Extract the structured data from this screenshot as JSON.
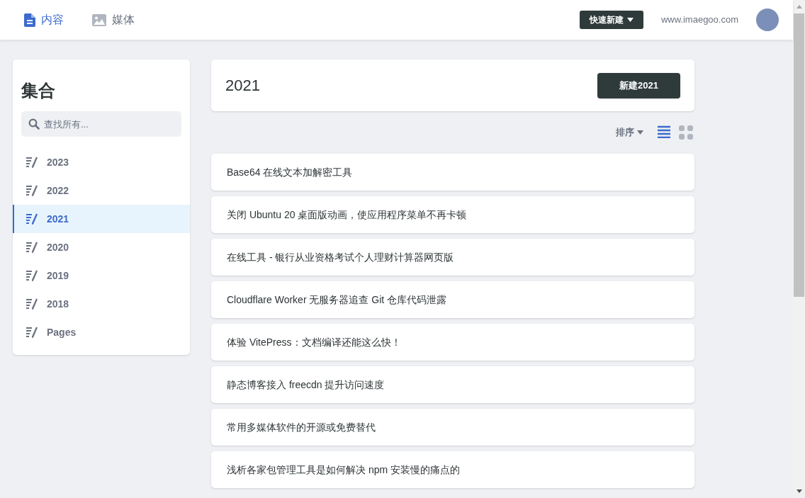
{
  "nav": {
    "tabs": [
      {
        "label": "内容",
        "kind": "document",
        "selected": true
      },
      {
        "label": "媒体",
        "kind": "image",
        "selected": false
      }
    ],
    "quick_new": "快速新建",
    "site": "www.imaegoo.com"
  },
  "sidebar": {
    "title": "集合",
    "search": {
      "placeholder": "查找所有..."
    },
    "items": [
      {
        "label": "2023",
        "selected": false
      },
      {
        "label": "2022",
        "selected": false
      },
      {
        "label": "2021",
        "selected": true
      },
      {
        "label": "2020",
        "selected": false
      },
      {
        "label": "2019",
        "selected": false
      },
      {
        "label": "2018",
        "selected": false
      },
      {
        "label": "Pages",
        "selected": false
      }
    ]
  },
  "header": {
    "title": "2021",
    "button": "新建2021"
  },
  "toolbar": {
    "sort": "排序",
    "views": [
      {
        "kind": "list",
        "selected": true
      },
      {
        "kind": "grid",
        "selected": false
      }
    ]
  },
  "posts": [
    "Base64 在线文本加解密工具",
    "关闭 Ubuntu 20 桌面版动画，使应用程序菜单不再卡顿",
    "在线工具 - 银行从业资格考试个人理财计算器网页版",
    "Cloudflare Worker 无服务器追查 Git 仓库代码泄露",
    "体验 VitePress：文档编译还能这么快！",
    "静态博客接入 freecdn 提升访问速度",
    "常用多媒体软件的开源或免费替代",
    "浅析各家包管理工具是如何解决 npm 安装慢的痛点的"
  ]
}
